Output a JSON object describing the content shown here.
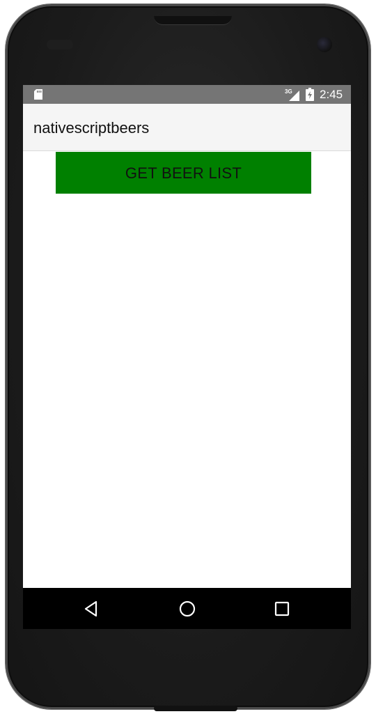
{
  "status_bar": {
    "network_label": "3G",
    "time": "2:45",
    "icons": [
      "sd-card-icon",
      "signal-3g-icon",
      "battery-charging-icon"
    ]
  },
  "action_bar": {
    "title": "nativescriptbeers"
  },
  "main": {
    "button_label": "GET BEER LIST"
  },
  "nav_bar": {
    "icons": [
      "back-icon",
      "home-icon",
      "recents-icon"
    ]
  },
  "colors": {
    "status_bar": "#757575",
    "action_bar": "#f5f5f5",
    "button": "#008000",
    "nav_bar": "#000000"
  }
}
